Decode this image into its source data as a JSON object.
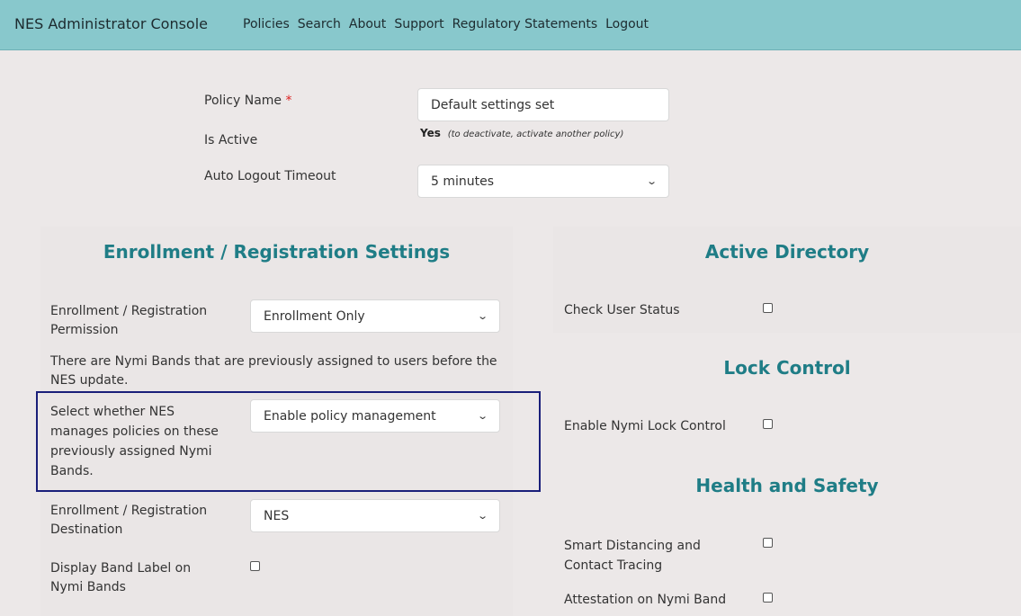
{
  "header": {
    "brand": "NES Administrator Console",
    "nav": [
      "Policies",
      "Search",
      "About",
      "Support",
      "Regulatory Statements",
      "Logout"
    ]
  },
  "policy": {
    "name_label": "Policy Name",
    "required_mark": "*",
    "name_value": "Default settings set",
    "active_label": "Is Active",
    "active_value": "Yes",
    "active_note": "(to deactivate, activate another policy)",
    "timeout_label": "Auto Logout Timeout",
    "timeout_value": "5 minutes"
  },
  "enrollment": {
    "heading": "Enrollment / Registration Settings",
    "permission_label": "Enrollment / Registration Permission",
    "permission_value": "Enrollment Only",
    "info_text": "There are Nymi Bands that are previously assigned to users before the NES update.",
    "manage_label": "Select whether NES manages policies on these previously assigned Nymi Bands.",
    "manage_value": "Enable policy management",
    "destination_label": "Enrollment / Registration Destination",
    "destination_value": "NES",
    "band_label_label": "Display Band Label on Nymi Bands"
  },
  "active_directory": {
    "heading": "Active Directory",
    "check_user_label": "Check User Status"
  },
  "lock_control": {
    "heading": "Lock Control",
    "enable_label": "Enable Nymi Lock Control"
  },
  "health": {
    "heading": "Health and Safety",
    "distancing_label": "Smart Distancing and Contact Tracing",
    "attestation_label": "Attestation on Nymi Band"
  }
}
